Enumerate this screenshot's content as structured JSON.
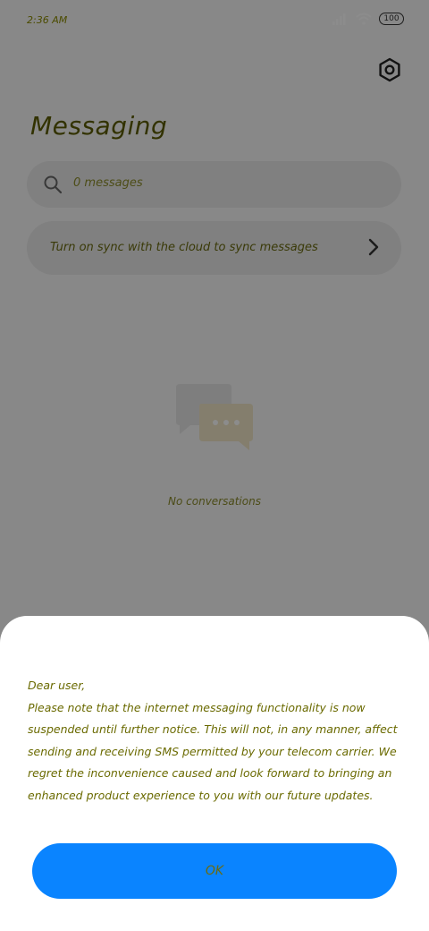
{
  "statusbar": {
    "time": "2:36 AM",
    "signal_icon": "signal-bars-icon",
    "wifi_icon": "wifi-icon",
    "battery_level": "100"
  },
  "header": {
    "title": "Messaging",
    "settings_icon": "gear-icon"
  },
  "search": {
    "placeholder": "0 messages",
    "icon": "search-icon"
  },
  "sync_banner": {
    "label": "Turn on sync with the cloud to sync messages",
    "icon": "chevron-right-icon"
  },
  "empty_state": {
    "icon": "chat-bubbles-icon",
    "label": "No conversations"
  },
  "dialog": {
    "greeting": "Dear user,",
    "message": "Please note that the internet messaging functionality is now suspended until further notice. This will not, in any manner, affect sending and receiving SMS permitted by your telecom carrier. We regret the inconvenience caused and look forward to bringing an enhanced product experience to you with our future updates.",
    "ok_label": "OK"
  },
  "colors": {
    "accent": "#0a84ff",
    "dim_overlay": "rgba(0,0,0,0.45)",
    "sheet_bg": "#ffffff"
  }
}
